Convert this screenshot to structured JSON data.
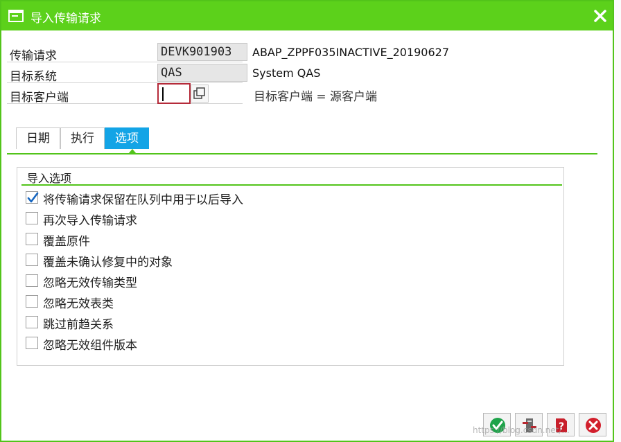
{
  "dialog": {
    "title": "导入传输请求",
    "close_icon": "close-icon"
  },
  "fields": {
    "request": {
      "label": "传输请求",
      "value": "DEVK901903",
      "description": "ABAP_ZPPF035INACTIVE_20190627"
    },
    "target_system": {
      "label": "目标系统",
      "value": "QAS",
      "description": "System QAS"
    },
    "target_client": {
      "label": "目标客户端",
      "value": "",
      "hint": "目标客户端 = 源客户端"
    }
  },
  "tabs": [
    {
      "label": "日期",
      "active": false
    },
    {
      "label": "执行",
      "active": false
    },
    {
      "label": "选项",
      "active": true
    }
  ],
  "options_group": {
    "title": "导入选项",
    "items": [
      {
        "label": "将传输请求保留在队列中用于以后导入",
        "checked": true
      },
      {
        "label": "再次导入传输请求",
        "checked": false
      },
      {
        "label": "覆盖原件",
        "checked": false
      },
      {
        "label": "覆盖未确认修复中的对象",
        "checked": false
      },
      {
        "label": "忽略无效传输类型",
        "checked": false
      },
      {
        "label": "忽略无效表类",
        "checked": false
      },
      {
        "label": "跳过前趋关系",
        "checked": false
      },
      {
        "label": "忽略无效组件版本",
        "checked": false
      }
    ]
  },
  "footer_buttons": [
    {
      "name": "confirm-button",
      "icon": "check-icon"
    },
    {
      "name": "import-button",
      "icon": "transport-icon"
    },
    {
      "name": "help-button",
      "icon": "help-icon"
    },
    {
      "name": "cancel-button",
      "icon": "cancel-icon"
    }
  ],
  "colors": {
    "titlebar": "#5cd11b",
    "active_tab": "#13a4e6",
    "accent_line": "#52c41a",
    "focus_border": "#b52b3a"
  },
  "watermark": "https://blog.csdn.net/..."
}
